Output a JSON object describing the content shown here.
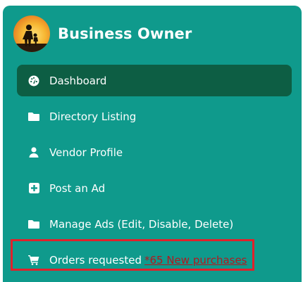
{
  "brand": {
    "title": "Business Owner",
    "avatar_icon": "person-silhouette-sunset-icon"
  },
  "nav": {
    "items": [
      {
        "label": "Dashboard",
        "icon": "dashboard-gauge-icon",
        "active": true
      },
      {
        "label": "Directory Listing",
        "icon": "folder-icon",
        "active": false
      },
      {
        "label": "Vendor Profile",
        "icon": "user-icon",
        "active": false
      },
      {
        "label": "Post an Ad",
        "icon": "plus-square-icon",
        "active": false
      },
      {
        "label": "Manage Ads (Edit, Disable, Delete)",
        "icon": "folder-icon",
        "active": false
      },
      {
        "label": "Orders requested",
        "icon": "cart-icon",
        "active": false,
        "link_text": "*65 New purchases"
      }
    ]
  },
  "colors": {
    "sidebar_bg": "#0f9a8c",
    "active_bg": "#0d5e44",
    "highlight_border": "#e0212b",
    "link": "#b3181f"
  }
}
